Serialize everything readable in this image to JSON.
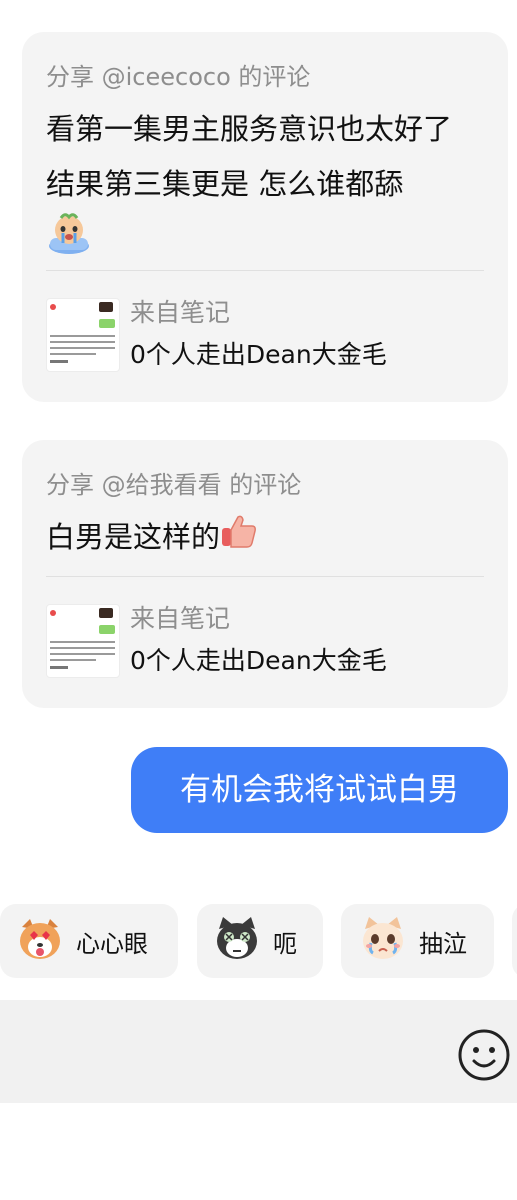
{
  "cards": [
    {
      "header_prefix": "分享 ",
      "header_user": "@iceecoco",
      "header_suffix": " 的评论",
      "body": "看第一集男主服务意识也太好了 结果第三集更是 怎么谁都舔",
      "body_emoji": "crying-emoji-icon",
      "note_label": "来自笔记",
      "note_title": "0个人走出Dean大金毛"
    },
    {
      "header_prefix": "分享 ",
      "header_user": "@给我看看",
      "header_suffix": " 的评论",
      "body": "白男是这样的",
      "body_emoji": "thumbs-up-icon",
      "note_label": "来自笔记",
      "note_title": "0个人走出Dean大金毛"
    }
  ],
  "message": {
    "text": "有机会我将试试白男",
    "color": "#3f7ef7"
  },
  "stickers": [
    {
      "label": "心心眼",
      "icon": "heart-eyes-dog-icon"
    },
    {
      "label": "呃",
      "icon": "awkward-cat-icon"
    },
    {
      "label": "抽泣",
      "icon": "sobbing-cat-icon"
    }
  ],
  "input_bar": {
    "emoji_icon": "smiley-face-icon"
  }
}
